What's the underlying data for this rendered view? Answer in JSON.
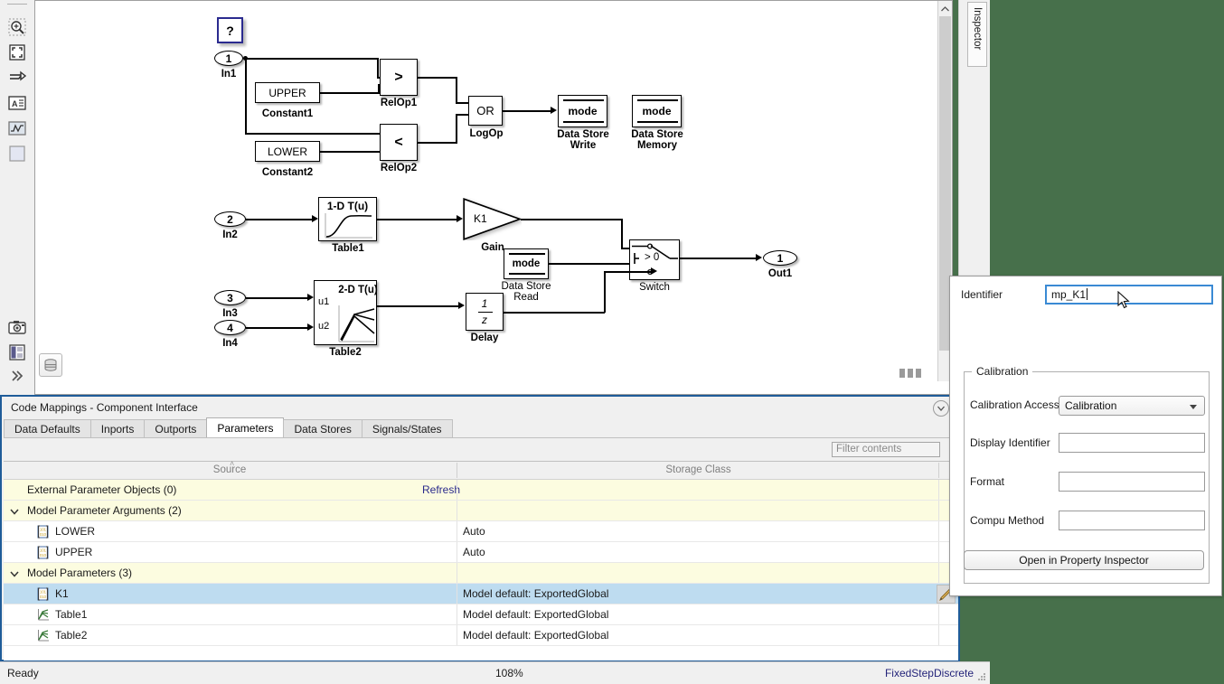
{
  "window": {
    "background_color": "#47704b"
  },
  "left_toolbar": {
    "items": [
      {
        "name": "zoom-in-icon",
        "label": "Zoom In"
      },
      {
        "name": "fit-to-view-icon",
        "label": "Fit To View"
      },
      {
        "name": "signal-routing-icon",
        "label": "Signal Routing"
      },
      {
        "name": "annotation-icon",
        "label": "Annotation"
      },
      {
        "name": "scope-icon",
        "label": "Scope"
      },
      {
        "name": "subsystem-icon",
        "label": "Subsystem"
      },
      {
        "name": "camera-icon",
        "label": "Screenshot"
      },
      {
        "name": "compare-icon",
        "label": "Compare"
      },
      {
        "name": "more-icon",
        "label": "More"
      }
    ]
  },
  "canvas": {
    "scroll_up_glyph": "˄",
    "model_browser_label": "Model Browser",
    "annotation": {
      "text": "?"
    },
    "blocks": [
      {
        "name": "In1",
        "port_number": "1",
        "label": "In1",
        "type": "inport"
      },
      {
        "name": "In2",
        "port_number": "2",
        "label": "In2",
        "type": "inport"
      },
      {
        "name": "In3",
        "port_number": "3",
        "label": "In3",
        "type": "inport"
      },
      {
        "name": "In4",
        "port_number": "4",
        "label": "In4",
        "type": "inport"
      },
      {
        "name": "Out1",
        "port_number": "1",
        "label": "Out1",
        "type": "outport"
      },
      {
        "name": "Constant1",
        "text": "UPPER",
        "label": "Constant1",
        "type": "constant"
      },
      {
        "name": "Constant2",
        "text": "LOWER",
        "label": "Constant2",
        "type": "constant"
      },
      {
        "name": "RelOp1",
        "text": ">",
        "label": "RelOp1",
        "type": "relational-operator"
      },
      {
        "name": "RelOp2",
        "text": "<",
        "label": "RelOp2",
        "type": "relational-operator"
      },
      {
        "name": "LogOp",
        "text": "OR",
        "label": "LogOp",
        "type": "logical-operator"
      },
      {
        "name": "DataStoreWrite",
        "text": "mode",
        "label": "Data Store\nWrite",
        "type": "data-store-write"
      },
      {
        "name": "DataStoreMemory",
        "text": "mode",
        "label": "Data Store\nMemory",
        "type": "data-store-memory"
      },
      {
        "name": "DataStoreRead",
        "text": "mode",
        "label": "Data Store\nRead",
        "type": "data-store-read"
      },
      {
        "name": "Table1",
        "text": "1-D T(u)",
        "label": "Table1",
        "type": "lookup-1d"
      },
      {
        "name": "Table2",
        "text": "2-D T(u)",
        "label": "Table2",
        "type": "lookup-2d",
        "input_labels": [
          "u1",
          "u2"
        ]
      },
      {
        "name": "Gain",
        "text": "K1",
        "label": "Gain",
        "type": "gain"
      },
      {
        "name": "Switch",
        "text": "> 0",
        "label": "Switch",
        "type": "switch"
      },
      {
        "name": "Delay",
        "text": "1/z",
        "numerator": "1",
        "denominator": "z",
        "label": "Delay",
        "type": "delay"
      }
    ]
  },
  "inspector_tab": {
    "label": "Inspector"
  },
  "code_mappings": {
    "title": "Code Mappings - Component Interface",
    "collapse_glyph": "▼",
    "tabs": [
      {
        "label": "Data Defaults",
        "active": false
      },
      {
        "label": "Inports",
        "active": false
      },
      {
        "label": "Outports",
        "active": false
      },
      {
        "label": "Parameters",
        "active": true
      },
      {
        "label": "Data Stores",
        "active": false
      },
      {
        "label": "Signals/States",
        "active": false
      }
    ],
    "filter": {
      "placeholder": "Filter contents",
      "value": ""
    },
    "columns": [
      {
        "label": "Source",
        "sorted": true,
        "sort_glyph": "˄"
      },
      {
        "label": "Storage Class",
        "sorted": false
      }
    ],
    "rows": [
      {
        "kind": "group",
        "source": "External Parameter Objects (0)",
        "storage_class": "",
        "link": "Refresh",
        "expandable": false,
        "selected": false
      },
      {
        "kind": "group",
        "source": "Model Parameter Arguments (2)",
        "storage_class": "",
        "expandable": true,
        "expanded": true,
        "selected": false
      },
      {
        "kind": "item",
        "source": "LOWER",
        "storage_class": "Auto",
        "icon": "parameter-icon",
        "selected": false
      },
      {
        "kind": "item",
        "source": "UPPER",
        "storage_class": "Auto",
        "icon": "parameter-icon",
        "selected": false
      },
      {
        "kind": "group",
        "source": "Model Parameters (3)",
        "storage_class": "",
        "expandable": true,
        "expanded": true,
        "selected": false
      },
      {
        "kind": "item",
        "source": "K1",
        "storage_class": "Model default: ExportedGlobal",
        "icon": "parameter-icon",
        "selected": true,
        "editing": true
      },
      {
        "kind": "item",
        "source": "Table1",
        "storage_class": "Model default: ExportedGlobal",
        "icon": "lookup-table-icon",
        "selected": false
      },
      {
        "kind": "item",
        "source": "Table2",
        "storage_class": "Model default: ExportedGlobal",
        "icon": "lookup-table-icon",
        "selected": false
      }
    ]
  },
  "property_popup": {
    "identifier": {
      "label": "Identifier",
      "value": "mp_K1"
    },
    "group": {
      "label": "Calibration"
    },
    "calibration_access": {
      "label": "Calibration Access",
      "value": "Calibration"
    },
    "display_identifier": {
      "label": "Display Identifier",
      "value": ""
    },
    "format": {
      "label": "Format",
      "value": ""
    },
    "compu_method": {
      "label": "Compu Method",
      "value": ""
    },
    "open_button": {
      "label": "Open in Property Inspector"
    }
  },
  "status_bar": {
    "status": "Ready",
    "zoom": "108%",
    "solver": "FixedStepDiscrete"
  }
}
